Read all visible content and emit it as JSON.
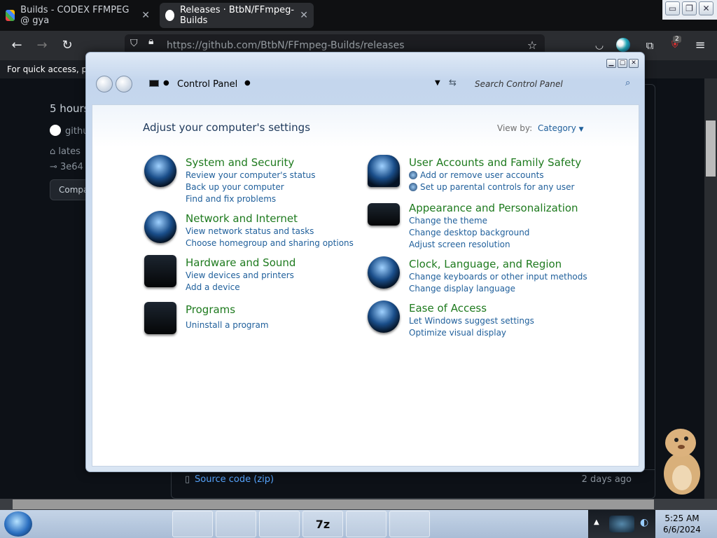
{
  "browser": {
    "tabs": [
      {
        "title": "Builds - CODEX FFMPEG @ gya",
        "close": "✕"
      },
      {
        "title": "Releases · BtbN/FFmpeg-Builds",
        "close": "✕"
      }
    ],
    "window_controls": [
      "▭",
      "❐",
      "✕"
    ],
    "url": "https://github.com/BtbN/FFmpeg-Builds/releases",
    "bookmarks_text": "For quick access, plac",
    "extension_badge": "2"
  },
  "github": {
    "left_items": [
      "5 hours",
      "githu",
      "lates",
      "3e64"
    ],
    "compare_button": "Compa",
    "source_code": "Source code (zip)",
    "source_time": "2 days ago"
  },
  "control_panel": {
    "breadcrumb": "Control Panel",
    "search_placeholder": "Search Control Panel",
    "heading": "Adjust your computer's settings",
    "view_by_label": "View by:",
    "view_by_value": "Category",
    "categories_left": [
      {
        "title": "System and Security",
        "links": [
          "Review your computer's status",
          "Back up your computer",
          "Find and fix problems"
        ]
      },
      {
        "title": "Network and Internet",
        "links": [
          "View network status and tasks",
          "Choose homegroup and sharing options"
        ]
      },
      {
        "title": "Hardware and Sound",
        "links": [
          "View devices and printers",
          "Add a device"
        ]
      },
      {
        "title": "Programs",
        "links": [
          "Uninstall a program"
        ]
      }
    ],
    "categories_right": [
      {
        "title": "User Accounts and Family Safety",
        "links": [
          "Add or remove user accounts",
          "Set up parental controls for any user"
        ]
      },
      {
        "title": "Appearance and Personalization",
        "links": [
          "Change the theme",
          "Change desktop background",
          "Adjust screen resolution"
        ]
      },
      {
        "title": "Clock, Language, and Region",
        "links": [
          "Change keyboards or other input methods",
          "Change display language"
        ]
      },
      {
        "title": "Ease of Access",
        "links": [
          "Let Windows suggest settings",
          "Optimize visual display"
        ]
      }
    ]
  },
  "taskbar": {
    "items": [
      "",
      "",
      "",
      "",
      "",
      "",
      "7z",
      "",
      ""
    ],
    "time": "5:25 AM",
    "date": "6/6/2024"
  }
}
